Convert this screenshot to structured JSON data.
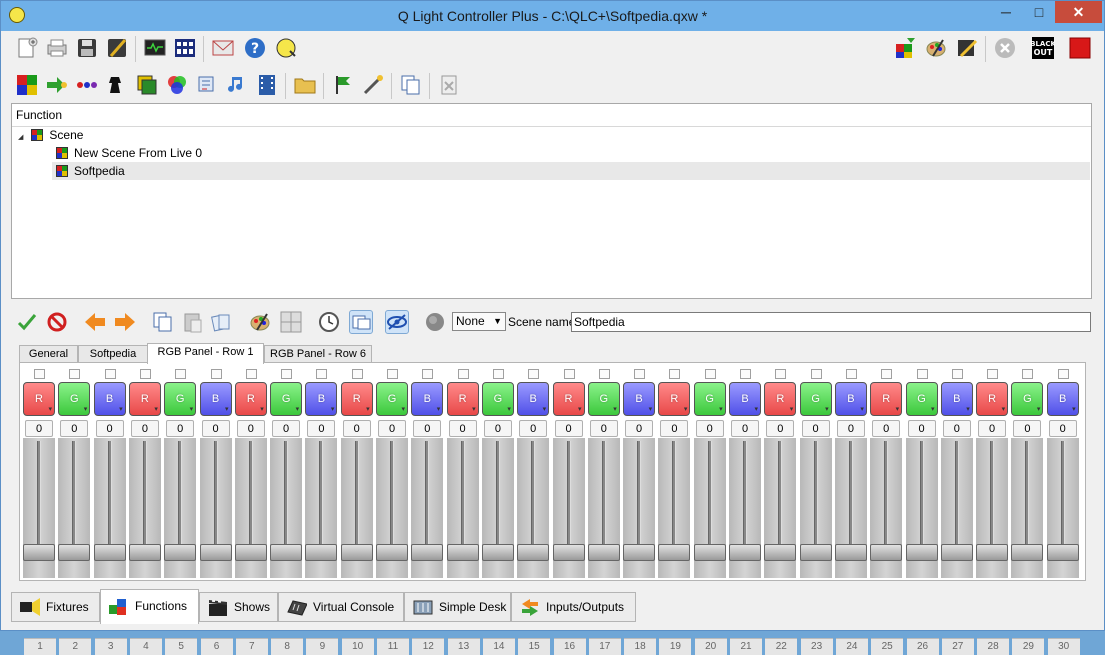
{
  "window": {
    "title": "Q Light Controller Plus - C:\\QLC+\\Softpedia.qxw *",
    "min": "─",
    "max": "□",
    "close": "✕"
  },
  "tree": {
    "header": "Function",
    "rows": [
      {
        "label": "Scene",
        "expander": "◢"
      },
      {
        "label": "New Scene From Live 0"
      },
      {
        "label": "Softpedia"
      }
    ]
  },
  "editor": {
    "speed_mode": "None",
    "scene_name_label": "Scene name:",
    "scene_name_value": "Softpedia",
    "tabs": [
      "General",
      "Softpedia",
      "RGB Panel - Row 1",
      "RGB Panel - Row 6"
    ],
    "active_tab": 2
  },
  "channels": {
    "colors": [
      "R",
      "G",
      "B",
      "R",
      "G",
      "B",
      "R",
      "G",
      "B",
      "R",
      "G",
      "B",
      "R",
      "G",
      "B",
      "R",
      "G",
      "B",
      "R",
      "G",
      "B",
      "R",
      "G",
      "B",
      "R",
      "G",
      "B",
      "R",
      "G",
      "B"
    ],
    "values": [
      "0",
      "0",
      "0",
      "0",
      "0",
      "0",
      "0",
      "0",
      "0",
      "0",
      "0",
      "0",
      "0",
      "0",
      "0",
      "0",
      "0",
      "0",
      "0",
      "0",
      "0",
      "0",
      "0",
      "0",
      "0",
      "0",
      "0",
      "0",
      "0",
      "0"
    ],
    "numbers": [
      "1",
      "2",
      "3",
      "4",
      "5",
      "6",
      "7",
      "8",
      "9",
      "10",
      "11",
      "12",
      "13",
      "14",
      "15",
      "16",
      "17",
      "18",
      "19",
      "20",
      "21",
      "22",
      "23",
      "24",
      "25",
      "26",
      "27",
      "28",
      "29",
      "30"
    ]
  },
  "bottom_tabs": [
    {
      "label": "Fixtures",
      "icon": "spotlight-icon"
    },
    {
      "label": "Functions",
      "icon": "functions-icon"
    },
    {
      "label": "Shows",
      "icon": "clapperboard-icon"
    },
    {
      "label": "Virtual Console",
      "icon": "mixer-icon"
    },
    {
      "label": "Simple Desk",
      "icon": "desk-icon"
    },
    {
      "label": "Inputs/Outputs",
      "icon": "arrows-icon"
    }
  ],
  "active_bottom_tab": 1
}
